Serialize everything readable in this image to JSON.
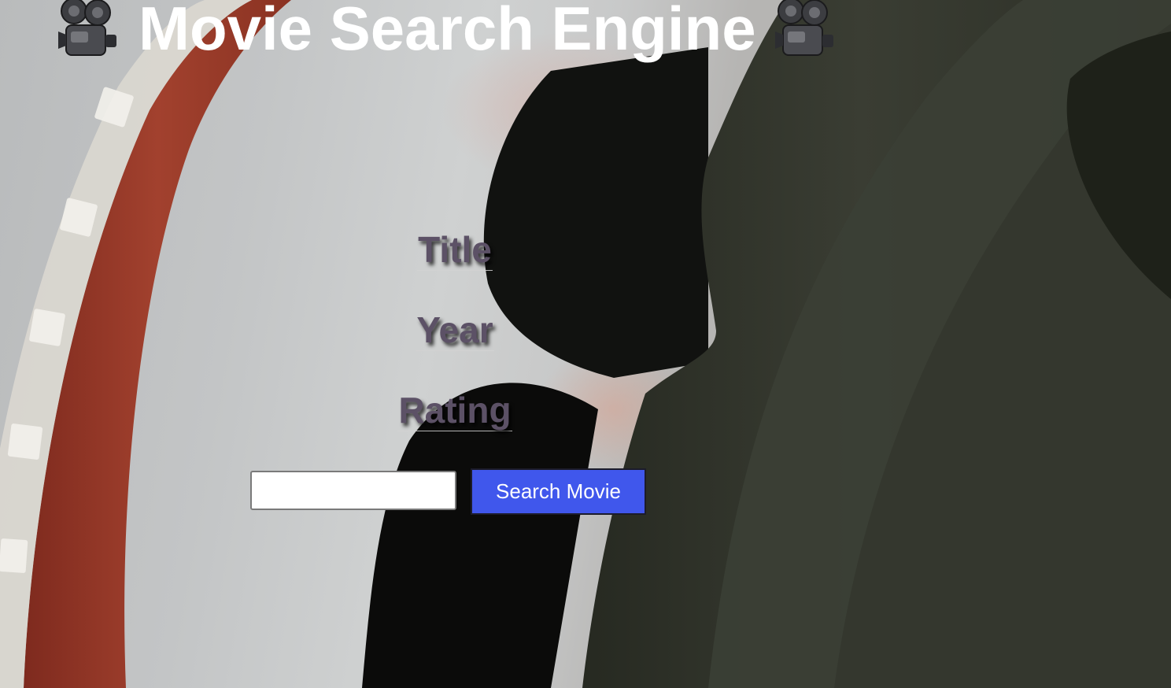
{
  "header": {
    "title": "Movie Search Engine",
    "left_icon": "movie-camera-icon",
    "right_icon": "movie-camera-icon"
  },
  "movie": {
    "title_label": "Title",
    "year_label": "Year",
    "rating_label": "Rating"
  },
  "search": {
    "value": "",
    "placeholder": "",
    "button_label": "Search Movie"
  },
  "colors": {
    "button_bg": "#4057ec",
    "label_text": "#5c5166",
    "title_text": "#ffffff"
  }
}
